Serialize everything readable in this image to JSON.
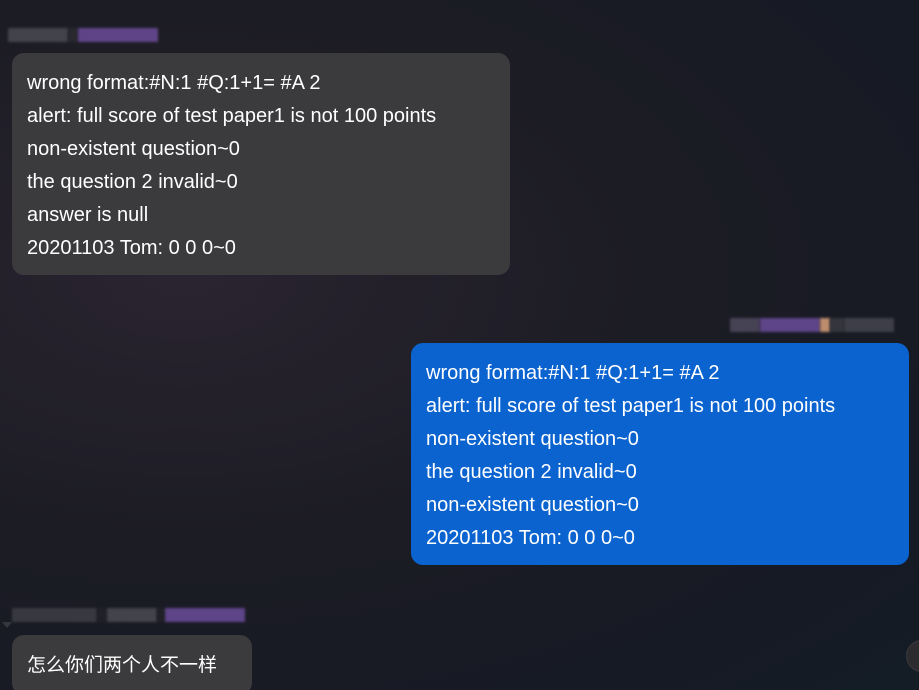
{
  "messages": [
    {
      "side": "left",
      "lines": [
        "wrong format:#N:1 #Q:1+1= #A 2",
        "alert: full score of test paper1 is not 100 points",
        "non-existent question~0",
        "the question 2 invalid~0",
        "answer is null",
        "20201103 Tom: 0 0 0~0"
      ]
    },
    {
      "side": "right",
      "lines": [
        "wrong format:#N:1 #Q:1+1= #A 2",
        "alert: full score of test paper1 is not 100 points",
        "non-existent question~0",
        "the question 2 invalid~0",
        "non-existent question~0",
        "20201103 Tom: 0 0 0~0"
      ]
    },
    {
      "side": "left",
      "lines": [
        "怎么你们两个人不一样"
      ]
    }
  ],
  "colors": {
    "left_bubble": "#3b3b3e",
    "right_bubble": "#0a63cf",
    "text": "#ffffff"
  }
}
